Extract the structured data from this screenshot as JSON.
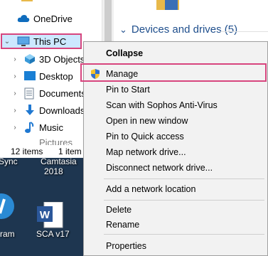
{
  "nav": {
    "onedrive": "OneDrive",
    "this_pc": "This PC",
    "items": [
      "3D Objects",
      "Desktop",
      "Documents",
      "Downloads",
      "Music",
      "Pictures"
    ]
  },
  "content": {
    "section_header": "Devices and drives (5)"
  },
  "status": {
    "count": "12 items",
    "selected": "1 item"
  },
  "desktop": {
    "label_top_left": "Sync",
    "label_top_center": "Camtasia",
    "label_top_year": "2018",
    "label_bottom_left": "ram",
    "label_bottom_center": "SCA v17"
  },
  "menu": {
    "collapse": "Collapse",
    "manage": "Manage",
    "pin_start": "Pin to Start",
    "scan": "Scan with Sophos Anti-Virus",
    "open_new": "Open in new window",
    "pin_quick": "Pin to Quick access",
    "map_drive": "Map network drive...",
    "disconnect_drive": "Disconnect network drive...",
    "add_location": "Add a network location",
    "delete": "Delete",
    "rename": "Rename",
    "properties": "Properties"
  },
  "icons": {
    "onedrive": "cloud-icon",
    "this_pc": "monitor-icon",
    "objects3d": "cube-icon",
    "desktop": "desktop-icon",
    "documents": "document-icon",
    "downloads": "download-arrow-icon",
    "music": "music-note-icon",
    "manage": "shield-icon",
    "word": "word-icon"
  },
  "colors": {
    "selection": "#cce8ff",
    "highlight_border": "#d7457e",
    "link_blue": "#1e4e8c",
    "menu_bg": "#f2f2f2"
  }
}
